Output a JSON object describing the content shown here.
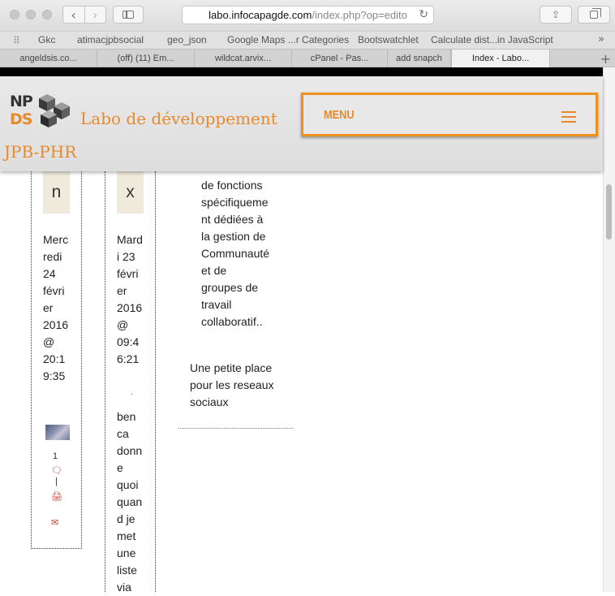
{
  "browser": {
    "url_host": "labo.infocapagde.com",
    "url_path": "/index.php?op=edito",
    "bookmarks": [
      "Gkc",
      "atimacjpbsocial",
      "geo_json",
      "Google Maps ...r Categories",
      "Bootswatchlet",
      "Calculate dist...in JavaScript"
    ],
    "bookmark_more": "»",
    "tabs": [
      "angeldsis.co...",
      "(off) (11) Em...",
      "wildcat.arvix...",
      "cPanel - Pas...",
      "add snapch",
      "Index - Labo..."
    ],
    "active_tab_index": 5
  },
  "site": {
    "logo_top": "NP",
    "logo_bottom": "DS",
    "title": "Labo de développement JPB-PHR",
    "menu_label": "MENU"
  },
  "col1": {
    "tag": "n",
    "date_lines": [
      "Merc",
      "redi",
      "24",
      "févri",
      "er",
      "2016",
      "@",
      "20:1",
      "9:35"
    ],
    "count": "1",
    "sep": "|"
  },
  "col2": {
    "tag": "x",
    "date_lines": [
      "Mard",
      "i 23",
      "févri",
      "er",
      "2016",
      "@",
      "09:4",
      "6:21"
    ],
    "dot": "·",
    "text_lines": [
      "ben",
      "ca",
      "donn",
      "e",
      "quoi",
      "quan",
      "d je",
      "met",
      "une",
      "liste",
      "via"
    ]
  },
  "col3": {
    "text_lines": [
      "de fonctions",
      "spécifiqueme",
      "nt dédiées à",
      "la gestion de",
      "Communauté",
      "et de",
      "groupes de",
      "travail",
      "collaboratif.."
    ],
    "social_lines": [
      "Une petite place",
      "pour les reseaux",
      "sociaux"
    ]
  },
  "colors": {
    "accent": "#e8892a",
    "tag_bg": "#efeadb"
  }
}
